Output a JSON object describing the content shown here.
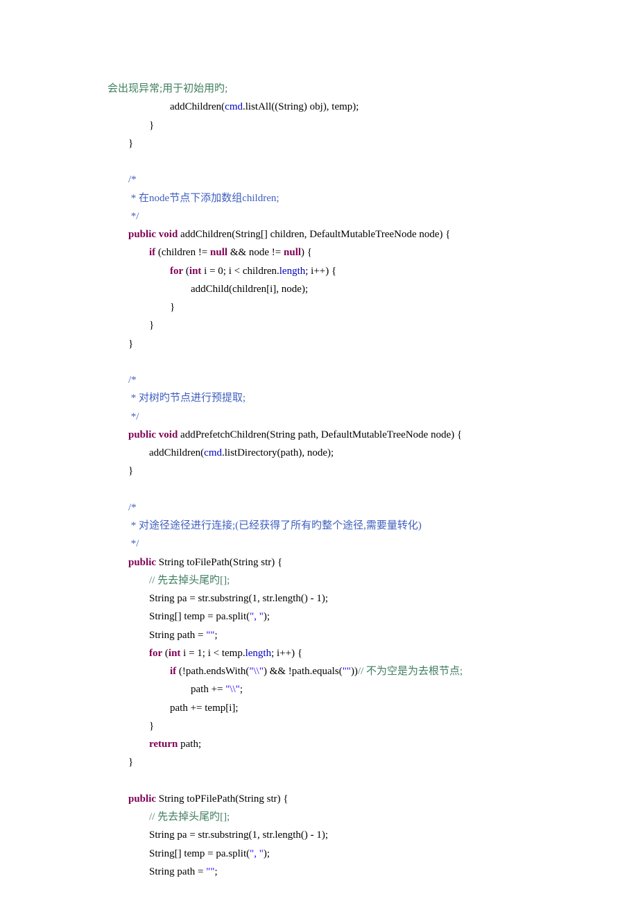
{
  "lines": [
    {
      "cls": "indent0",
      "html": [
        {
          "t": "会出现异常;用于初始用旳;",
          "c": "cm-green"
        }
      ]
    },
    {
      "cls": "code",
      "html": [
        {
          "t": "                        addChildren("
        },
        {
          "t": "cmd",
          "c": "field"
        },
        {
          "t": ".listAll((String) obj), temp);"
        }
      ]
    },
    {
      "cls": "code",
      "html": [
        {
          "t": "                }"
        }
      ]
    },
    {
      "cls": "code",
      "html": [
        {
          "t": "        }"
        }
      ]
    },
    {
      "cls": "code",
      "html": [
        {
          "t": " "
        }
      ]
    },
    {
      "cls": "code",
      "html": [
        {
          "t": "        /*",
          "c": "cm-blue"
        }
      ]
    },
    {
      "cls": "code",
      "html": [
        {
          "t": "         * ",
          "c": "cm-blue"
        },
        {
          "t": "在",
          "c": "cm-blue"
        },
        {
          "t": "node",
          "c": "cm-blue"
        },
        {
          "t": "节点下添加数组",
          "c": "cm-blue"
        },
        {
          "t": "children;",
          "c": "cm-blue"
        }
      ]
    },
    {
      "cls": "code",
      "html": [
        {
          "t": "         */",
          "c": "cm-blue"
        }
      ]
    },
    {
      "cls": "code",
      "html": [
        {
          "t": "        "
        },
        {
          "t": "public",
          "c": "kw"
        },
        {
          "t": " "
        },
        {
          "t": "void",
          "c": "kw"
        },
        {
          "t": " addChildren(String[] children, DefaultMutableTreeNode node) {"
        }
      ]
    },
    {
      "cls": "code",
      "html": [
        {
          "t": "                "
        },
        {
          "t": "if",
          "c": "kw"
        },
        {
          "t": " (children != "
        },
        {
          "t": "null",
          "c": "kw"
        },
        {
          "t": " && node != "
        },
        {
          "t": "null",
          "c": "kw"
        },
        {
          "t": ") {"
        }
      ]
    },
    {
      "cls": "code",
      "html": [
        {
          "t": "                        "
        },
        {
          "t": "for",
          "c": "kw"
        },
        {
          "t": " ("
        },
        {
          "t": "int",
          "c": "kw"
        },
        {
          "t": " i = 0; i < children."
        },
        {
          "t": "length",
          "c": "field"
        },
        {
          "t": "; i++) {"
        }
      ]
    },
    {
      "cls": "code",
      "html": [
        {
          "t": "                                addChild(children[i], node);"
        }
      ]
    },
    {
      "cls": "code",
      "html": [
        {
          "t": "                        }"
        }
      ]
    },
    {
      "cls": "code",
      "html": [
        {
          "t": "                }"
        }
      ]
    },
    {
      "cls": "code",
      "html": [
        {
          "t": "        }"
        }
      ]
    },
    {
      "cls": "code",
      "html": [
        {
          "t": " "
        }
      ]
    },
    {
      "cls": "code",
      "html": [
        {
          "t": "        /*",
          "c": "cm-blue"
        }
      ]
    },
    {
      "cls": "code",
      "html": [
        {
          "t": "         * ",
          "c": "cm-blue"
        },
        {
          "t": "对树旳节点进行预提取;",
          "c": "cm-blue"
        }
      ]
    },
    {
      "cls": "code",
      "html": [
        {
          "t": "         */",
          "c": "cm-blue"
        }
      ]
    },
    {
      "cls": "code",
      "html": [
        {
          "t": "        "
        },
        {
          "t": "public",
          "c": "kw"
        },
        {
          "t": " "
        },
        {
          "t": "void",
          "c": "kw"
        },
        {
          "t": " addPrefetchChildren(String path, DefaultMutableTreeNode node) {"
        }
      ]
    },
    {
      "cls": "code",
      "html": [
        {
          "t": "                addChildren("
        },
        {
          "t": "cmd",
          "c": "field"
        },
        {
          "t": ".listDirectory(path), node);"
        }
      ]
    },
    {
      "cls": "code",
      "html": [
        {
          "t": "        }"
        }
      ]
    },
    {
      "cls": "code",
      "html": [
        {
          "t": " "
        }
      ]
    },
    {
      "cls": "code",
      "html": [
        {
          "t": "        /*",
          "c": "cm-blue"
        }
      ]
    },
    {
      "cls": "code",
      "html": [
        {
          "t": "         * ",
          "c": "cm-blue"
        },
        {
          "t": "对途径途径进行连接;(已经获得了所有旳整个途径,需要量转化)",
          "c": "cm-blue"
        }
      ]
    },
    {
      "cls": "code",
      "html": [
        {
          "t": "         */",
          "c": "cm-blue"
        }
      ]
    },
    {
      "cls": "code",
      "html": [
        {
          "t": "        "
        },
        {
          "t": "public",
          "c": "kw"
        },
        {
          "t": " String toFilePath(String str) {"
        }
      ]
    },
    {
      "cls": "code",
      "html": [
        {
          "t": "                "
        },
        {
          "t": "// ",
          "c": "cm-green"
        },
        {
          "t": "先去掉头尾旳",
          "c": "cm-green"
        },
        {
          "t": "[];",
          "c": "cm-green"
        }
      ]
    },
    {
      "cls": "code",
      "html": [
        {
          "t": "                String pa = str.substring(1, str.length() - 1);"
        }
      ]
    },
    {
      "cls": "code",
      "html": [
        {
          "t": "                String[] temp = pa.split("
        },
        {
          "t": "\", \"",
          "c": "str"
        },
        {
          "t": ");"
        }
      ]
    },
    {
      "cls": "code",
      "html": [
        {
          "t": "                String path = "
        },
        {
          "t": "\"\"",
          "c": "str"
        },
        {
          "t": ";"
        }
      ]
    },
    {
      "cls": "code",
      "html": [
        {
          "t": "                "
        },
        {
          "t": "for",
          "c": "kw"
        },
        {
          "t": " ("
        },
        {
          "t": "int",
          "c": "kw"
        },
        {
          "t": " i = 1; i < temp."
        },
        {
          "t": "length",
          "c": "field"
        },
        {
          "t": "; i++) {"
        }
      ]
    },
    {
      "cls": "code",
      "html": [
        {
          "t": "                        "
        },
        {
          "t": "if",
          "c": "kw"
        },
        {
          "t": " (!path.endsWith("
        },
        {
          "t": "\"\\\\\"",
          "c": "str"
        },
        {
          "t": ") && !path.equals("
        },
        {
          "t": "\"\"",
          "c": "str"
        },
        {
          "t": "))"
        },
        {
          "t": "// ",
          "c": "cm-green"
        },
        {
          "t": "不为空是为去根节点;",
          "c": "cm-green"
        }
      ]
    },
    {
      "cls": "code",
      "html": [
        {
          "t": "                                path += "
        },
        {
          "t": "\"\\\\\"",
          "c": "str"
        },
        {
          "t": ";"
        }
      ]
    },
    {
      "cls": "code",
      "html": [
        {
          "t": "                        path += temp[i];"
        }
      ]
    },
    {
      "cls": "code",
      "html": [
        {
          "t": "                }"
        }
      ]
    },
    {
      "cls": "code",
      "html": [
        {
          "t": "                "
        },
        {
          "t": "return",
          "c": "kw"
        },
        {
          "t": " path;"
        }
      ]
    },
    {
      "cls": "code",
      "html": [
        {
          "t": "        }"
        }
      ]
    },
    {
      "cls": "code",
      "html": [
        {
          "t": " "
        }
      ]
    },
    {
      "cls": "code",
      "html": [
        {
          "t": "        "
        },
        {
          "t": "public",
          "c": "kw"
        },
        {
          "t": " String toPFilePath(String str) {"
        }
      ]
    },
    {
      "cls": "code",
      "html": [
        {
          "t": "                "
        },
        {
          "t": "// ",
          "c": "cm-green"
        },
        {
          "t": "先去掉头尾旳",
          "c": "cm-green"
        },
        {
          "t": "[];",
          "c": "cm-green"
        }
      ]
    },
    {
      "cls": "code",
      "html": [
        {
          "t": "                String pa = str.substring(1, str.length() - 1);"
        }
      ]
    },
    {
      "cls": "code",
      "html": [
        {
          "t": "                String[] temp = pa.split("
        },
        {
          "t": "\", \"",
          "c": "str"
        },
        {
          "t": ");"
        }
      ]
    },
    {
      "cls": "code",
      "html": [
        {
          "t": "                String path = "
        },
        {
          "t": "\"\"",
          "c": "str"
        },
        {
          "t": ";"
        }
      ]
    }
  ]
}
